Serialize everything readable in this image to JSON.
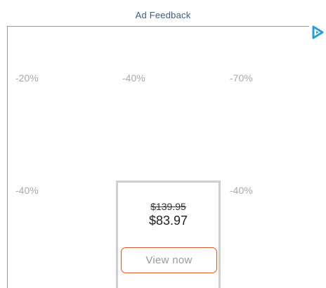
{
  "header": {
    "ad_feedback_label": "Ad Feedback"
  },
  "adchoices": {
    "icon": "adchoices-icon",
    "color": "#2a9fd6"
  },
  "discounts": {
    "row1": [
      "-20%",
      "-40%",
      "-70%"
    ],
    "row2": [
      "-40%",
      "-40%"
    ]
  },
  "product": {
    "old_price": "$139.95",
    "new_price": "$83.97",
    "cta_label": "View now",
    "cta_border_color": "#d95a2b"
  }
}
